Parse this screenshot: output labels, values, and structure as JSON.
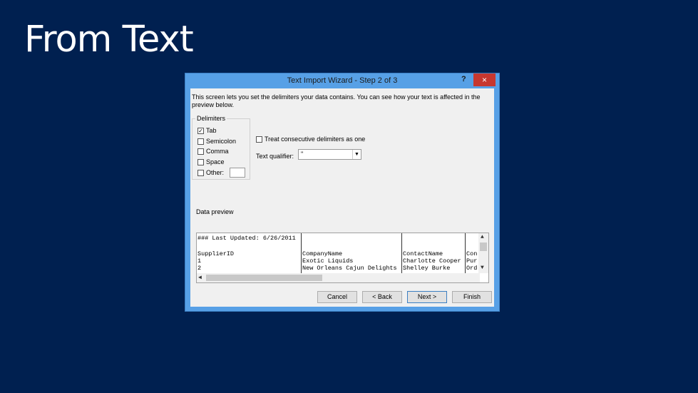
{
  "slide": {
    "title": "From Text"
  },
  "dialog": {
    "title": "Text Import Wizard - Step 2 of 3",
    "help": "?",
    "close": "×",
    "description": "This screen lets you set the delimiters your data contains. You can see how your text is affected in the preview below.",
    "delimiters": {
      "legend": "Delimiters",
      "items": [
        {
          "label": "Tab",
          "checked": true
        },
        {
          "label": "Semicolon",
          "checked": false
        },
        {
          "label": "Comma",
          "checked": false
        },
        {
          "label": "Space",
          "checked": false
        },
        {
          "label": "Other:",
          "checked": false
        }
      ],
      "other_value": ""
    },
    "consecutive": {
      "label": "Treat consecutive delimiters as one",
      "checked": false
    },
    "qualifier": {
      "label": "Text qualifier:",
      "value": "\""
    },
    "preview": {
      "label": "Data preview",
      "columns": [
        [
          "### Last Updated: 6/26/2011",
          "",
          "SupplierID",
          "1",
          "2"
        ],
        [
          "",
          "",
          "CompanyName",
          "Exotic Liquids",
          "New Orleans Cajun Delights"
        ],
        [
          "",
          "",
          "ContactName",
          "Charlotte Cooper",
          "Shelley Burke"
        ],
        [
          "",
          "",
          "Con",
          "Pur",
          "Ord"
        ]
      ]
    },
    "buttons": {
      "cancel": "Cancel",
      "back": "< Back",
      "next": "Next >",
      "finish": "Finish"
    }
  }
}
